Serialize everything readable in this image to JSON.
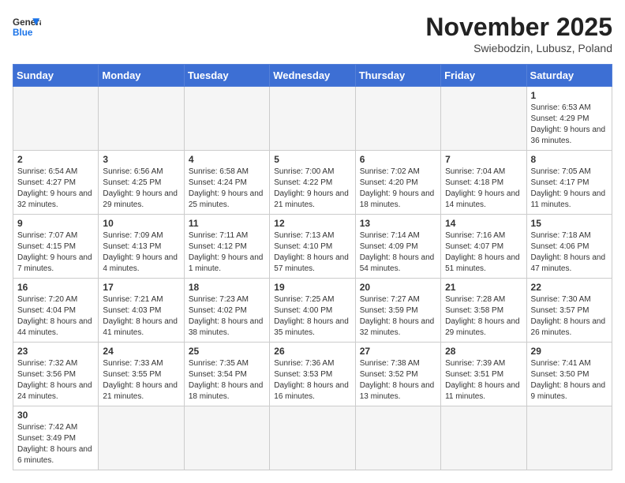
{
  "logo": {
    "general": "General",
    "blue": "Blue"
  },
  "title": "November 2025",
  "subtitle": "Swiebodzin, Lubusz, Poland",
  "days_of_week": [
    "Sunday",
    "Monday",
    "Tuesday",
    "Wednesday",
    "Thursday",
    "Friday",
    "Saturday"
  ],
  "weeks": [
    [
      {
        "day": "",
        "info": ""
      },
      {
        "day": "",
        "info": ""
      },
      {
        "day": "",
        "info": ""
      },
      {
        "day": "",
        "info": ""
      },
      {
        "day": "",
        "info": ""
      },
      {
        "day": "",
        "info": ""
      },
      {
        "day": "1",
        "info": "Sunrise: 6:53 AM\nSunset: 4:29 PM\nDaylight: 9 hours\nand 36 minutes."
      }
    ],
    [
      {
        "day": "2",
        "info": "Sunrise: 6:54 AM\nSunset: 4:27 PM\nDaylight: 9 hours\nand 32 minutes."
      },
      {
        "day": "3",
        "info": "Sunrise: 6:56 AM\nSunset: 4:25 PM\nDaylight: 9 hours\nand 29 minutes."
      },
      {
        "day": "4",
        "info": "Sunrise: 6:58 AM\nSunset: 4:24 PM\nDaylight: 9 hours\nand 25 minutes."
      },
      {
        "day": "5",
        "info": "Sunrise: 7:00 AM\nSunset: 4:22 PM\nDaylight: 9 hours\nand 21 minutes."
      },
      {
        "day": "6",
        "info": "Sunrise: 7:02 AM\nSunset: 4:20 PM\nDaylight: 9 hours\nand 18 minutes."
      },
      {
        "day": "7",
        "info": "Sunrise: 7:04 AM\nSunset: 4:18 PM\nDaylight: 9 hours\nand 14 minutes."
      },
      {
        "day": "8",
        "info": "Sunrise: 7:05 AM\nSunset: 4:17 PM\nDaylight: 9 hours\nand 11 minutes."
      }
    ],
    [
      {
        "day": "9",
        "info": "Sunrise: 7:07 AM\nSunset: 4:15 PM\nDaylight: 9 hours\nand 7 minutes."
      },
      {
        "day": "10",
        "info": "Sunrise: 7:09 AM\nSunset: 4:13 PM\nDaylight: 9 hours\nand 4 minutes."
      },
      {
        "day": "11",
        "info": "Sunrise: 7:11 AM\nSunset: 4:12 PM\nDaylight: 9 hours\nand 1 minute."
      },
      {
        "day": "12",
        "info": "Sunrise: 7:13 AM\nSunset: 4:10 PM\nDaylight: 8 hours\nand 57 minutes."
      },
      {
        "day": "13",
        "info": "Sunrise: 7:14 AM\nSunset: 4:09 PM\nDaylight: 8 hours\nand 54 minutes."
      },
      {
        "day": "14",
        "info": "Sunrise: 7:16 AM\nSunset: 4:07 PM\nDaylight: 8 hours\nand 51 minutes."
      },
      {
        "day": "15",
        "info": "Sunrise: 7:18 AM\nSunset: 4:06 PM\nDaylight: 8 hours\nand 47 minutes."
      }
    ],
    [
      {
        "day": "16",
        "info": "Sunrise: 7:20 AM\nSunset: 4:04 PM\nDaylight: 8 hours\nand 44 minutes."
      },
      {
        "day": "17",
        "info": "Sunrise: 7:21 AM\nSunset: 4:03 PM\nDaylight: 8 hours\nand 41 minutes."
      },
      {
        "day": "18",
        "info": "Sunrise: 7:23 AM\nSunset: 4:02 PM\nDaylight: 8 hours\nand 38 minutes."
      },
      {
        "day": "19",
        "info": "Sunrise: 7:25 AM\nSunset: 4:00 PM\nDaylight: 8 hours\nand 35 minutes."
      },
      {
        "day": "20",
        "info": "Sunrise: 7:27 AM\nSunset: 3:59 PM\nDaylight: 8 hours\nand 32 minutes."
      },
      {
        "day": "21",
        "info": "Sunrise: 7:28 AM\nSunset: 3:58 PM\nDaylight: 8 hours\nand 29 minutes."
      },
      {
        "day": "22",
        "info": "Sunrise: 7:30 AM\nSunset: 3:57 PM\nDaylight: 8 hours\nand 26 minutes."
      }
    ],
    [
      {
        "day": "23",
        "info": "Sunrise: 7:32 AM\nSunset: 3:56 PM\nDaylight: 8 hours\nand 24 minutes."
      },
      {
        "day": "24",
        "info": "Sunrise: 7:33 AM\nSunset: 3:55 PM\nDaylight: 8 hours\nand 21 minutes."
      },
      {
        "day": "25",
        "info": "Sunrise: 7:35 AM\nSunset: 3:54 PM\nDaylight: 8 hours\nand 18 minutes."
      },
      {
        "day": "26",
        "info": "Sunrise: 7:36 AM\nSunset: 3:53 PM\nDaylight: 8 hours\nand 16 minutes."
      },
      {
        "day": "27",
        "info": "Sunrise: 7:38 AM\nSunset: 3:52 PM\nDaylight: 8 hours\nand 13 minutes."
      },
      {
        "day": "28",
        "info": "Sunrise: 7:39 AM\nSunset: 3:51 PM\nDaylight: 8 hours\nand 11 minutes."
      },
      {
        "day": "29",
        "info": "Sunrise: 7:41 AM\nSunset: 3:50 PM\nDaylight: 8 hours\nand 9 minutes."
      }
    ],
    [
      {
        "day": "30",
        "info": "Sunrise: 7:42 AM\nSunset: 3:49 PM\nDaylight: 8 hours\nand 6 minutes."
      },
      {
        "day": "",
        "info": ""
      },
      {
        "day": "",
        "info": ""
      },
      {
        "day": "",
        "info": ""
      },
      {
        "day": "",
        "info": ""
      },
      {
        "day": "",
        "info": ""
      },
      {
        "day": "",
        "info": ""
      }
    ]
  ]
}
